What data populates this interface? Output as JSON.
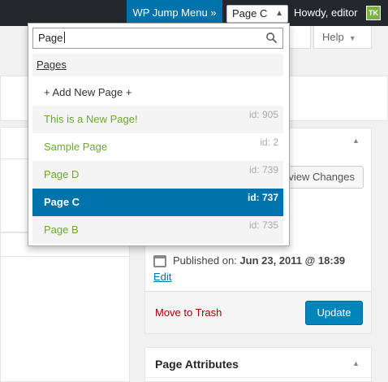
{
  "adminbar": {
    "jump_menu_label": "WP Jump Menu »",
    "jump_select_value": "Page C",
    "greeting": "Howdy, editor",
    "avatar_initials": "TK"
  },
  "screen_tabs": {
    "help_label": "Help"
  },
  "publish": {
    "preview_label": "view Changes",
    "published_label": "Published on:",
    "published_date": "Jun 23, 2011 @ 18:39",
    "edit_label": "Edit",
    "trash_label": "Move to Trash",
    "update_label": "Update"
  },
  "page_attributes": {
    "title": "Page Attributes"
  },
  "dropdown": {
    "search_value": "Page",
    "group_label": "Pages",
    "options": [
      {
        "label": "+ Add New Page +",
        "id": ""
      },
      {
        "label": "This is a New Page!",
        "id": "id: 905"
      },
      {
        "label": "Sample Page",
        "id": "id: 2"
      },
      {
        "label": "Page D",
        "id": "id: 739"
      },
      {
        "label": "Page C",
        "id": "id: 737"
      },
      {
        "label": "Page B",
        "id": "id: 735"
      }
    ]
  },
  "colors": {
    "adminbar_bg": "#23282d",
    "accent": "#0073aa",
    "match_green": "#6aaa2f",
    "update_button": "#0085ba",
    "trash_red": "#a00"
  }
}
